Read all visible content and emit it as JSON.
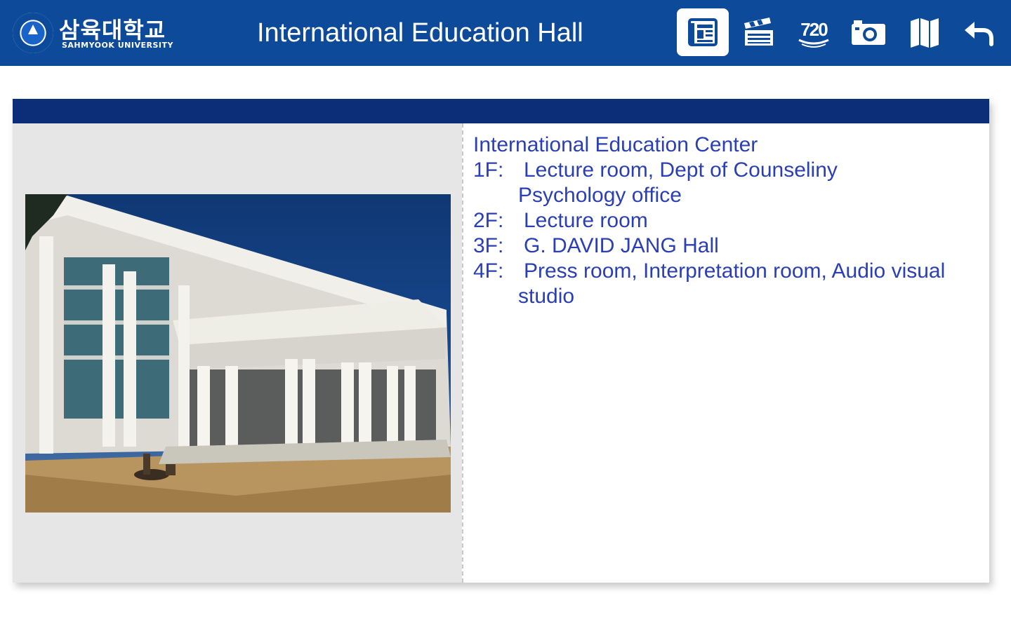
{
  "header": {
    "logo": {
      "korean": "삼육대학교",
      "english": "SAHMYOOK UNIVERSITY"
    },
    "title": "International Education Hall",
    "bg_color": "#0d4a9a",
    "tools": [
      {
        "icon": "document-icon",
        "active": true
      },
      {
        "icon": "clapperboard-icon",
        "active": false
      },
      {
        "icon": "vr-720-icon",
        "label": "720",
        "active": false
      },
      {
        "icon": "camera-icon",
        "active": false
      },
      {
        "icon": "map-icon",
        "active": false
      },
      {
        "icon": "back-arrow-icon",
        "active": false
      }
    ]
  },
  "content": {
    "bar_color": "#0c2d78",
    "text_color": "#2b3fb5",
    "info": {
      "heading": "International Education Center",
      "floors": [
        {
          "floor": "1F:",
          "line1": "Lecture room, Dept of Counseliny",
          "line2": "Psychology office"
        },
        {
          "floor": "2F:",
          "line1": "Lecture room"
        },
        {
          "floor": "3F:",
          "line1": "G. DAVID JANG Hall"
        },
        {
          "floor": "4F:",
          "line1": "Press room, Interpretation room, Audio visual",
          "line2": "studio"
        }
      ]
    }
  }
}
